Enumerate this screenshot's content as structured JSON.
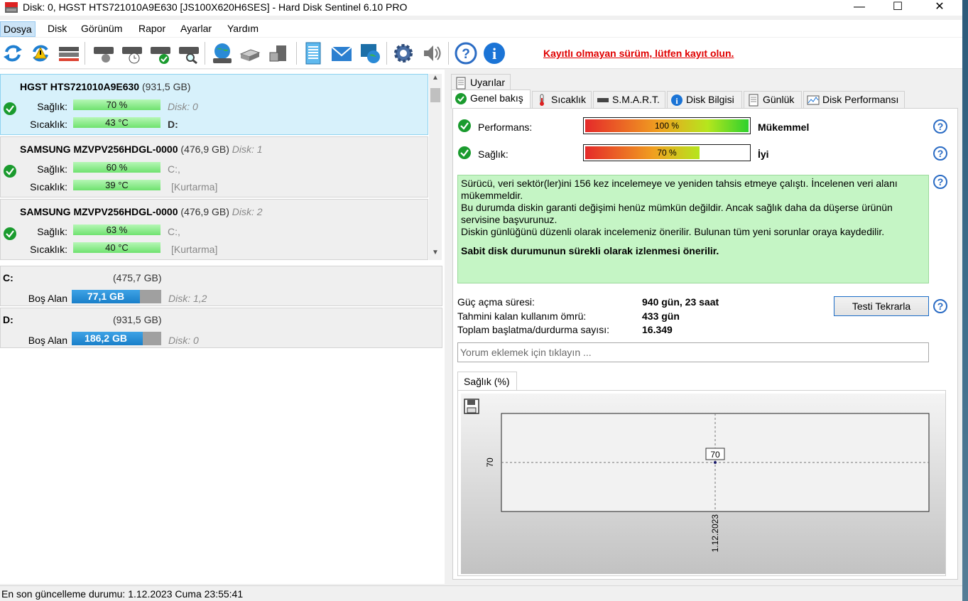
{
  "window": {
    "title": "Disk: 0, HGST HTS721010A9E630 [JS100X620H6SES]  -  Hard Disk Sentinel 6.10 PRO",
    "minimize": "—",
    "maximize": "☐",
    "close": "✕"
  },
  "menu": [
    "Dosya",
    "Disk",
    "Görünüm",
    "Rapor",
    "Ayarlar",
    "Yardım"
  ],
  "toolbar": {
    "icons": [
      "refresh-icon",
      "refresh-warning-icon",
      "disk-list-icon",
      "disk-surface-icon",
      "disk-clock-icon",
      "disk-check-icon",
      "disk-search-icon",
      "globe-disk-icon",
      "drive-icon",
      "server-icon",
      "report-icon",
      "mail-icon",
      "web-icon",
      "settings-icon",
      "sound-icon",
      "help-icon",
      "info-icon"
    ],
    "registration_warning": "Kayıtlı olmayan sürüm, lütfen kayıt olun."
  },
  "disks": [
    {
      "model": "HGST HTS721010A9E630",
      "size": "(931,5 GB)",
      "disk_no": "",
      "health_label": "Sağlık:",
      "health": "70 %",
      "health_pct": 70,
      "temp_label": "Sıcaklık:",
      "temp": "43 °C",
      "info1": "Disk: 0",
      "info2": "D:",
      "selected": true
    },
    {
      "model": "SAMSUNG MZVPV256HDGL-0000",
      "size": "(476,9 GB)",
      "disk_no": "Disk: 1",
      "health_label": "Sağlık:",
      "health": "60 %",
      "health_pct": 60,
      "temp_label": "Sıcaklık:",
      "temp": "39 °C",
      "info1": "C:,",
      "info2": "[Kurtarma]",
      "selected": false
    },
    {
      "model": "SAMSUNG MZVPV256HDGL-0000",
      "size": "(476,9 GB)",
      "disk_no": "Disk: 2",
      "health_label": "Sağlık:",
      "health": "63 %",
      "health_pct": 63,
      "temp_label": "Sıcaklık:",
      "temp": "40 °C",
      "info1": "C:,",
      "info2": "[Kurtarma]",
      "selected": false
    }
  ],
  "volumes": [
    {
      "letter": "C:",
      "size": "(475,7 GB)",
      "free_label": "Boş Alan",
      "free": "77,1 GB",
      "free_fraction": 0.162,
      "disk": "Disk: 1,2"
    },
    {
      "letter": "D:",
      "size": "(931,5 GB)",
      "free_label": "Boş Alan",
      "free": "186,2 GB",
      "free_fraction": 0.2,
      "disk": "Disk: 0"
    }
  ],
  "tabs": {
    "top": "Uyarılar",
    "row": [
      "Genel bakış",
      "Sıcaklık",
      "S.M.A.R.T.",
      "Disk Bilgisi",
      "Günlük",
      "Disk Performansı"
    ]
  },
  "overview": {
    "performance_label": "Performans:",
    "performance_value": "100 %",
    "performance_pct": 100,
    "performance_rating": "Mükemmel",
    "health_label": "Sağlık:",
    "health_value": "70 %",
    "health_pct": 70,
    "health_rating": "İyi",
    "message_lines": [
      "Sürücü, veri sektör(ler)ini 156 kez incelemeye ve yeniden tahsis etmeye çalıştı. İncelenen veri alanı mükemmeldir.",
      "Bu durumda diskin garanti değişimi henüz mümkün değildir. Ancak sağlık daha da düşerse ürünün servisine başvurunuz.",
      "Diskin günlüğünü düzenli olarak incelemeniz önerilir. Bulunan tüm yeni sorunlar oraya kaydedilir."
    ],
    "message_bold": "Sabit disk durumunun sürekli olarak izlenmesi önerilir.",
    "stats": [
      {
        "label": "Güç açma süresi:",
        "value": "940 gün, 23 saat"
      },
      {
        "label": "Tahmini kalan kullanım ömrü:",
        "value": "433 gün"
      },
      {
        "label": "Toplam başlatma/durdurma sayısı:",
        "value": "16.349"
      }
    ],
    "retest_button": "Testi Tekrarla",
    "comment_placeholder": "Yorum eklemek için tıklayın ...",
    "chart_tab": "Sağlık (%)"
  },
  "chart_data": {
    "type": "line",
    "x": [
      "1.12.2023"
    ],
    "series": [
      {
        "values": [
          70
        ]
      }
    ],
    "point_labels": [
      "70"
    ],
    "ytick": "70",
    "xtick": "1.12.2023"
  },
  "statusbar": "En son güncelleme durumu: 1.12.2023 Cuma 23:55:41"
}
